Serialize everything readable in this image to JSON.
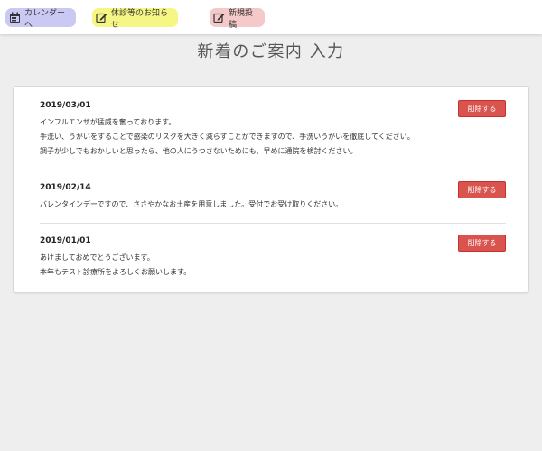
{
  "nav": {
    "calendar_label": "カレンダーへ",
    "notice_label": "休診等のお知らせ",
    "newpost_label": "新規投稿",
    "colors": {
      "calendar": "#c9c9f3",
      "notice": "#f6f684",
      "newpost": "#f5c9c9"
    },
    "icons": {
      "calendar": "calendar-icon",
      "notice": "edit-icon",
      "newpost": "edit-icon"
    }
  },
  "page": {
    "title": "新着のご案内 入力"
  },
  "entries": [
    {
      "date": "2019/03/01",
      "lines": [
        "インフルエンザが猛威を奮っております。",
        "手洗い、うがいをすることで感染のリスクを大きく減らすことができますので、手洗いうがいを徹底してください。",
        "調子が少しでもおかしいと思ったら、他の人にうつさないためにも、早めに通院を検討ください。"
      ],
      "delete_label": "削除する"
    },
    {
      "date": "2019/02/14",
      "lines": [
        "バレンタインデーですので、ささやかなお土産を用意しました。受付でお受け取りください。"
      ],
      "delete_label": "削除する"
    },
    {
      "date": "2019/01/01",
      "lines": [
        "あけましておめでとうございます。",
        "本年もテスト診療所をよろしくお願いします。"
      ],
      "delete_label": "削除する"
    }
  ],
  "colors": {
    "delete_button": "#d9534f",
    "background": "#eeeeee"
  }
}
